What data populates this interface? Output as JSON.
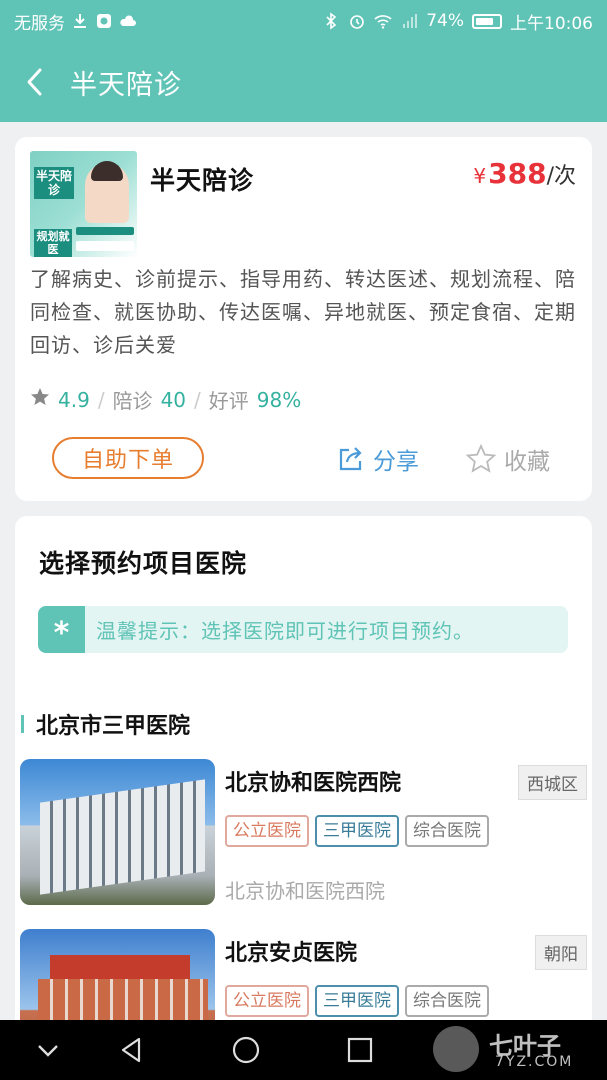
{
  "status_bar": {
    "carrier": "无服务",
    "battery": "74%",
    "time": "上午10:06"
  },
  "nav": {
    "title": "半天陪诊"
  },
  "product": {
    "title": "半天陪诊",
    "currency": "¥",
    "price": "388",
    "unit": "/次",
    "description": "了解病史、诊前提示、指导用药、转达医述、规划流程、陪同检查、就医协助、传达医嘱、异地就医、预定食宿、定期回访、诊后关爱",
    "rating": "4.9",
    "accompany_label": "陪诊",
    "accompany_count": "40",
    "praise_label": "好评",
    "praise_rate": "98%",
    "order_button": "自助下单",
    "share_button": "分享",
    "favorite_button": "收藏",
    "thumbnail": {
      "tag": "半天陪诊",
      "tag2": "规划就医"
    }
  },
  "hospital_section": {
    "title": "选择预约项目医院",
    "tip_badge": "*",
    "tip_text": "温馨提示：选择医院即可进行项目预约。",
    "group_title": "北京市三甲医院",
    "hospitals": [
      {
        "name": "北京协和医院西院",
        "district": "西城区",
        "tags": [
          "公立医院",
          "三甲医院",
          "综合医院"
        ],
        "subtitle": "北京协和医院西院"
      },
      {
        "name": "北京安贞医院",
        "district": "朝阳",
        "tags": [
          "公立医院",
          "三甲医院",
          "综合医院"
        ]
      }
    ]
  },
  "watermark": {
    "brand": "七叶子",
    "domain": "7YZ.COM"
  },
  "colors": {
    "primary": "#5fc3b6",
    "price": "#e8323a",
    "order": "#e77d2f",
    "share": "#4a9bd8"
  }
}
